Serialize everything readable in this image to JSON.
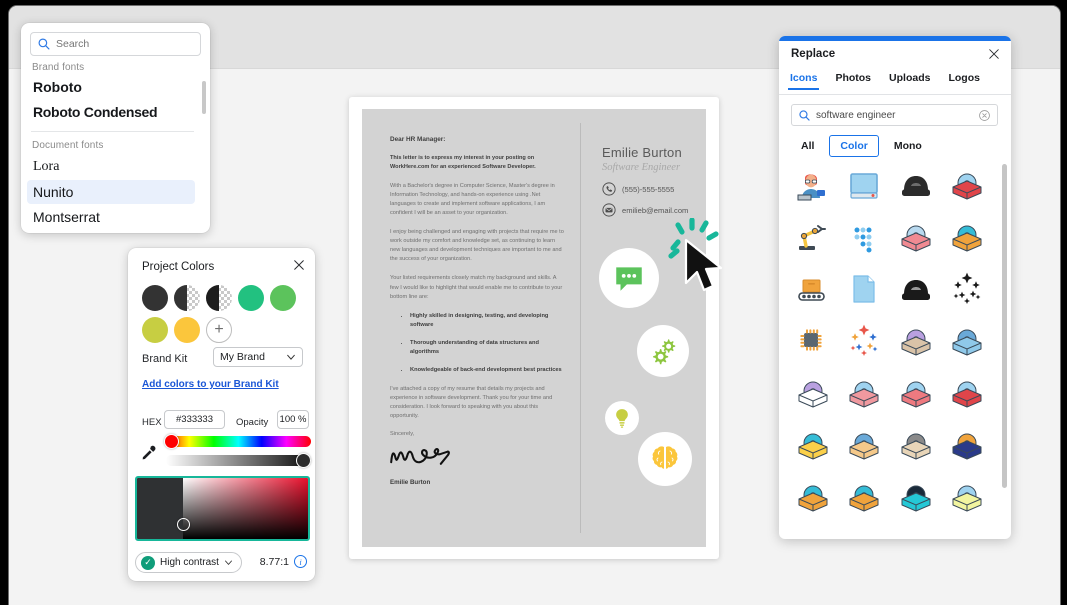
{
  "window": {
    "background": "#f3f3f3",
    "topbar_color": "#e2e2e2"
  },
  "font_picker": {
    "search": {
      "placeholder": "Search",
      "value": "",
      "icon": "search-icon"
    },
    "groups": [
      {
        "label": "Brand fonts",
        "fonts": [
          {
            "name": "Roboto",
            "selected": false
          },
          {
            "name": "Roboto Condensed",
            "selected": false
          }
        ]
      },
      {
        "label": "Document fonts",
        "fonts": [
          {
            "name": "Lora",
            "selected": false
          },
          {
            "name": "Nunito",
            "selected": true
          },
          {
            "name": "Montserrat",
            "selected": false
          }
        ]
      }
    ]
  },
  "project_colors": {
    "title": "Project Colors",
    "close_icon": "close-icon",
    "swatches": [
      {
        "name": "dark-charcoal",
        "color": "#333333",
        "type": "solid"
      },
      {
        "name": "dark-charcoal-60",
        "color": "#333333",
        "type": "half-alpha"
      },
      {
        "name": "dark-charcoal-40",
        "color": "#1d1d1d",
        "type": "half-alpha"
      },
      {
        "name": "spring-green",
        "color": "#22c180",
        "type": "solid"
      },
      {
        "name": "medium-green",
        "color": "#5cc35c",
        "type": "solid"
      },
      {
        "name": "yellow-green",
        "color": "#9ccb3b",
        "type": "solid"
      },
      {
        "name": "olive-yellow",
        "color": "#c7ce42",
        "type": "solid"
      },
      {
        "name": "golden-yellow",
        "color": "#fbc63c",
        "type": "solid"
      }
    ],
    "add_swatch_label": "+",
    "brand_kit_label": "Brand Kit",
    "brand_kit_value": "My Brand",
    "brand_kit_options": [
      "My Brand"
    ],
    "add_colors_link": "Add colors to your Brand Kit",
    "hex_label": "HEX",
    "hex_value": "#333333",
    "opacity_label": "Opacity",
    "opacity_value": "100 %",
    "eyedropper_icon": "eyedropper-icon",
    "contrast_label": "High contrast",
    "contrast_ratio": "8.77:1",
    "contrast_check_icon": "check-circle-icon",
    "contrast_info_icon": "info-icon",
    "selected_swatch_border": "#17b79a"
  },
  "document": {
    "salutation": "Dear HR Manager:",
    "paragraphs": [
      {
        "bold": true,
        "text": "This letter is to express my interest in your posting on WorkHere.com for an experienced Software Developer."
      },
      {
        "bold": false,
        "text": "With a Bachelor's degree in Computer Science, Master's degree in Information Technology, and hands-on experience using .Net languages to create and implement software applications, I am confident I will be an asset to your organization."
      },
      {
        "bold": false,
        "text": "I enjoy being challenged and engaging with projects that require me to work outside my comfort and knowledge set, as continuing to learn new languages and development techniques are important to me and the success of your organization."
      },
      {
        "bold": false,
        "text": "Your listed requirements closely match my background and skills. A few I would like to highlight that would enable me to contribute to your bottom line are:"
      }
    ],
    "bullets": [
      "Highly skilled in designing, testing, and developing software",
      "Thorough understanding of data structures and algorithms",
      "Knowledgeable of back-end development best practices"
    ],
    "closing_paragraph": "I've attached a copy of my resume that details my projects and experience in software development. Thank you for your time and consideration. I look forward to speaking with you about this opportunity.",
    "signoff": "Sincerely,",
    "signature_alt": "handwritten-signature",
    "signature_name": "Emilie Burton",
    "sidebar": {
      "name": "Emilie Burton",
      "role": "Software Engineer",
      "phone": "(555)-555-5555",
      "phone_icon": "phone-icon",
      "email": "emilieb@email.com",
      "email_icon": "envelope-icon",
      "float_icons": [
        {
          "name": "chat-bubble-icon",
          "color": "#5cc35c"
        },
        {
          "name": "gears-icon",
          "color": "#8dc63f"
        },
        {
          "name": "lightbulb-icon",
          "color": "#c7ce42"
        },
        {
          "name": "brain-icon",
          "color": "#fbc63c"
        }
      ]
    }
  },
  "cursor": {
    "name": "mouse-pointer",
    "click_effect": "click-burst",
    "burst_color": "#18b79a"
  },
  "replace_panel": {
    "title": "Replace",
    "close_icon": "close-icon",
    "accent_color": "#1a73e8",
    "tabs": [
      {
        "label": "Icons",
        "active": true
      },
      {
        "label": "Photos",
        "active": false
      },
      {
        "label": "Uploads",
        "active": false
      },
      {
        "label": "Logos",
        "active": false
      }
    ],
    "search": {
      "placeholder": "Search",
      "value": "software engineer",
      "icon": "search-icon",
      "clear_icon": "clear-circle-icon"
    },
    "filters": [
      {
        "label": "All",
        "active": false
      },
      {
        "label": "Color",
        "active": true
      },
      {
        "label": "Mono",
        "active": false
      }
    ],
    "icons": [
      {
        "name": "developer-avatar-icon",
        "c1": "#e8564a",
        "c2": "#4a90c4",
        "c3": "#f3b08a",
        "style": "person"
      },
      {
        "name": "desktop-monitor-icon",
        "c1": "#9fd3f0",
        "c2": "#6aa9d8",
        "c3": "#e8564a",
        "style": "monitor"
      },
      {
        "name": "hard-hat-icon",
        "c1": "#2b2b2b",
        "c2": "#6d6d6d",
        "c3": "#2b2b2b",
        "style": "dome"
      },
      {
        "name": "disc-in-red-box-icon",
        "c1": "#e0454a",
        "c2": "#9fd3f0",
        "c3": "#c8353a",
        "style": "box"
      },
      {
        "name": "robot-arm-icon",
        "c1": "#f6c640",
        "c2": "#3f4a54",
        "c3": "#e8a43a",
        "style": "arm"
      },
      {
        "name": "blue-dots-grid-icon",
        "c1": "#2f9ae0",
        "c2": "#8fcdf0",
        "c3": "#2f9ae0",
        "style": "dots"
      },
      {
        "name": "disc-in-pink-box-icon",
        "c1": "#f08a92",
        "c2": "#b8d9ef",
        "c3": "#e0454a",
        "style": "box"
      },
      {
        "name": "disc-in-orange-box-icon",
        "c1": "#f0a33c",
        "c2": "#35bcd6",
        "c3": "#d98c2c",
        "style": "box"
      },
      {
        "name": "conveyor-belt-box-icon",
        "c1": "#f0a33c",
        "c2": "#3f4a54",
        "c3": "#d98c2c",
        "style": "conveyor"
      },
      {
        "name": "document-page-icon",
        "c1": "#9fd3f0",
        "c2": "#7cbde8",
        "c3": "#9fd3f0",
        "style": "page"
      },
      {
        "name": "dark-hard-hat-icon",
        "c1": "#1a1a1a",
        "c2": "#9a9a9a",
        "c3": "#1a1a1a",
        "style": "dome"
      },
      {
        "name": "sparkle-cluster-black-icon",
        "c1": "#1a1a1a",
        "c2": "#1a1a1a",
        "c3": "#1a1a1a",
        "style": "sparkle"
      },
      {
        "name": "microchip-icon",
        "c1": "#5a6670",
        "c2": "#f0a33c",
        "c3": "#5a6670",
        "style": "chip"
      },
      {
        "name": "sparkle-cluster-color-icon",
        "c1": "#e8564a",
        "c2": "#f0a33c",
        "c3": "#2f6fd0",
        "style": "sparkle"
      },
      {
        "name": "disc-in-beige-box-icon",
        "c1": "#d9c3a8",
        "c2": "#b9a0e0",
        "c3": "#8a6fc4",
        "style": "box"
      },
      {
        "name": "disc-in-blue-box-icon",
        "c1": "#8fc9ea",
        "c2": "#6aa9d8",
        "c3": "#5a9fd0",
        "style": "box"
      },
      {
        "name": "disc-in-white-box-icon",
        "c1": "#ffffff",
        "c2": "#b9a0e0",
        "c3": "#8a6fc4",
        "style": "box"
      },
      {
        "name": "disc-in-salmon-box-icon",
        "c1": "#f0999f",
        "c2": "#9fd3f0",
        "c3": "#e0454a",
        "style": "box"
      },
      {
        "name": "disc-in-coral-box-icon",
        "c1": "#ee7a80",
        "c2": "#9fd3f0",
        "c3": "#e0454a",
        "style": "box"
      },
      {
        "name": "disc-in-crimson-box-icon",
        "c1": "#e0454a",
        "c2": "#9fd3f0",
        "c3": "#c8353a",
        "style": "box"
      },
      {
        "name": "disc-in-yellow-box-icon",
        "c1": "#fbd04a",
        "c2": "#35bcd6",
        "c3": "#8a6fc4",
        "style": "box"
      },
      {
        "name": "disc-in-tan-box-icon",
        "c1": "#f5c98a",
        "c2": "#6aa9d8",
        "c3": "#2f6fd0",
        "style": "box"
      },
      {
        "name": "disc-in-cream-box-icon",
        "c1": "#e8d5b8",
        "c2": "#8a8a8a",
        "c3": "#5a4a3a",
        "style": "box"
      },
      {
        "name": "disc-in-navy-box-icon",
        "c1": "#2a3a8a",
        "c2": "#f0a33c",
        "c3": "#e8564a",
        "style": "box"
      },
      {
        "name": "disc-in-amber-box-icon",
        "c1": "#f0a33c",
        "c2": "#35bcd6",
        "c3": "#4a3020",
        "style": "box"
      },
      {
        "name": "disc-in-open-box-icon",
        "c1": "#f0a33c",
        "c2": "#35bcd6",
        "c3": "#f5c98a",
        "style": "box"
      },
      {
        "name": "disc-in-teal-box-icon",
        "c1": "#25c8d6",
        "c2": "#1a2a3a",
        "c3": "#25c8d6",
        "style": "box"
      },
      {
        "name": "disc-in-lime-box-icon",
        "c1": "#f2f5a0",
        "c2": "#9fd3f0",
        "c3": "#d8dd70",
        "style": "box"
      }
    ],
    "scrollbar": "vertical-scrollbar"
  }
}
